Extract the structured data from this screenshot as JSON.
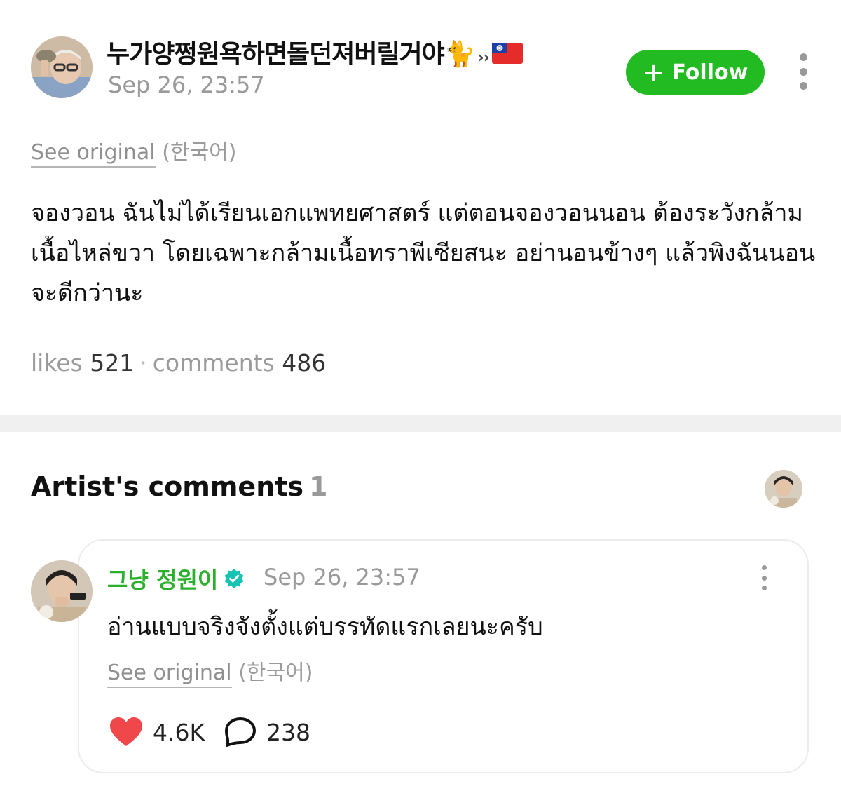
{
  "post": {
    "author_name": "누가양쩡원욕하면돌던져버릴거야",
    "author_suffix": "››",
    "date": "Sep 26, 23:57",
    "follow_label": "Follow",
    "see_original_label": "See original",
    "see_original_lang": "(한국어)",
    "body": "จองวอน ฉันไม่ได้เรียนเอกแพทยศาสตร์ แต่ตอนจองวอนนอน ต้องระวังกล้ามเนื้อไหล่ขวา โดยเฉพาะกล้ามเนื้อทราพีเซียสนะ อย่านอนข้างๆ แล้วพิงฉันนอนจะดีกว่านะ",
    "likes_label": "likes",
    "likes_count": "521",
    "comments_label": "comments",
    "comments_count": "486"
  },
  "artist_comments": {
    "title": "Artist's comments",
    "count": "1",
    "comment": {
      "author": "그냥 정원이",
      "date": "Sep 26, 23:57",
      "text": "อ่านแบบจริงจังตั้งแต่บรรทัดแรกเลยนะครับ",
      "see_original_label": "See original",
      "see_original_lang": "(한국어)",
      "likes": "4.6K",
      "replies": "238"
    }
  },
  "icons": {
    "author_emoji": "cat-icon",
    "flag": "taiwan-flag-icon",
    "verified": "verified-check-icon",
    "like": "heart-icon",
    "reply": "speech-bubble-icon",
    "more": "more-vertical-icon"
  },
  "colors": {
    "follow_button": "#22bb22",
    "artist_name": "#2cb02c",
    "verified_badge": "#17c3b2",
    "heart": "#f0474b",
    "muted_text": "#9a9a9a"
  }
}
